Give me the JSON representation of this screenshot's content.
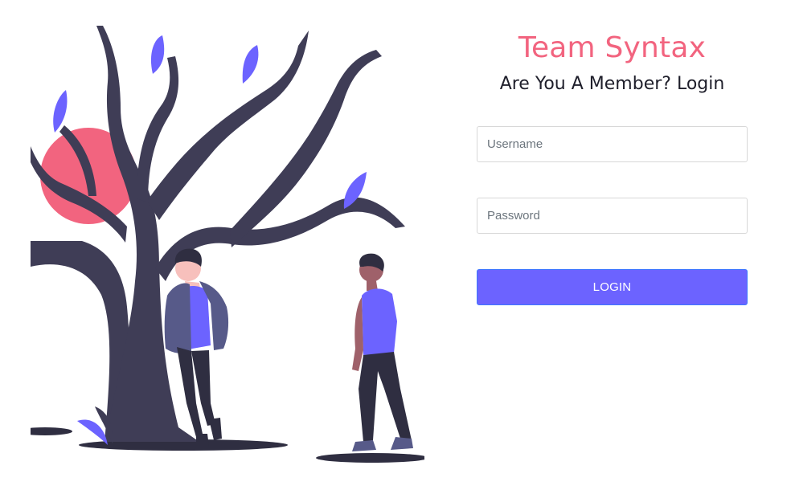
{
  "brand": {
    "title": "Team Syntax",
    "title_color": "#f2647f"
  },
  "login": {
    "subtitle": "Are You A Member? Login",
    "username_placeholder": "Username",
    "username_value": "",
    "password_placeholder": "Password",
    "password_value": "",
    "button_label": "LOGIN",
    "button_color": "#6c63ff"
  },
  "illustration": {
    "description_icon": "tree-and-people-illustration",
    "accent": "#f2647f",
    "leaf_color": "#6c63ff",
    "tree_color": "#3f3d56"
  }
}
